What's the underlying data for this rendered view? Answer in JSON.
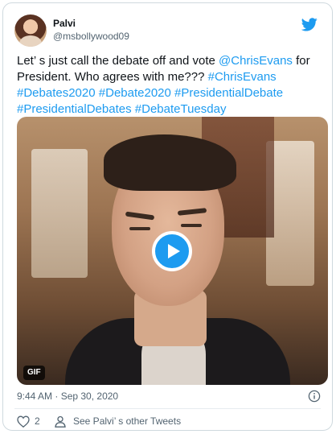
{
  "user": {
    "name": "Palvi",
    "handle": "@msbollywood09"
  },
  "tweet": {
    "text_intro": "Let’ s just call the debate off and vote ",
    "mention": "@ChrisEvans",
    "text_middle": " for President. Who agrees with me???  ",
    "hashtags": [
      "#ChrisEvans",
      "#Debates2020",
      "#Debate2020",
      "#PresidentialDebate",
      "#PresidentialDebates",
      "#DebateTuesday"
    ]
  },
  "media": {
    "badge": "GIF"
  },
  "meta": {
    "timestamp": "9:44 AM · Sep 30, 2020"
  },
  "actions": {
    "like_count": "2",
    "profile_link": "See Palvi’ s other Tweets"
  },
  "icons": {
    "brand": "twitter-bird-icon",
    "play": "play-icon",
    "info": "info-icon",
    "like": "heart-icon",
    "profile": "person-icon"
  },
  "colors": {
    "accent": "#1d9bf0",
    "text": "#0f1419",
    "muted": "#536471",
    "border": "#cfd9de"
  }
}
